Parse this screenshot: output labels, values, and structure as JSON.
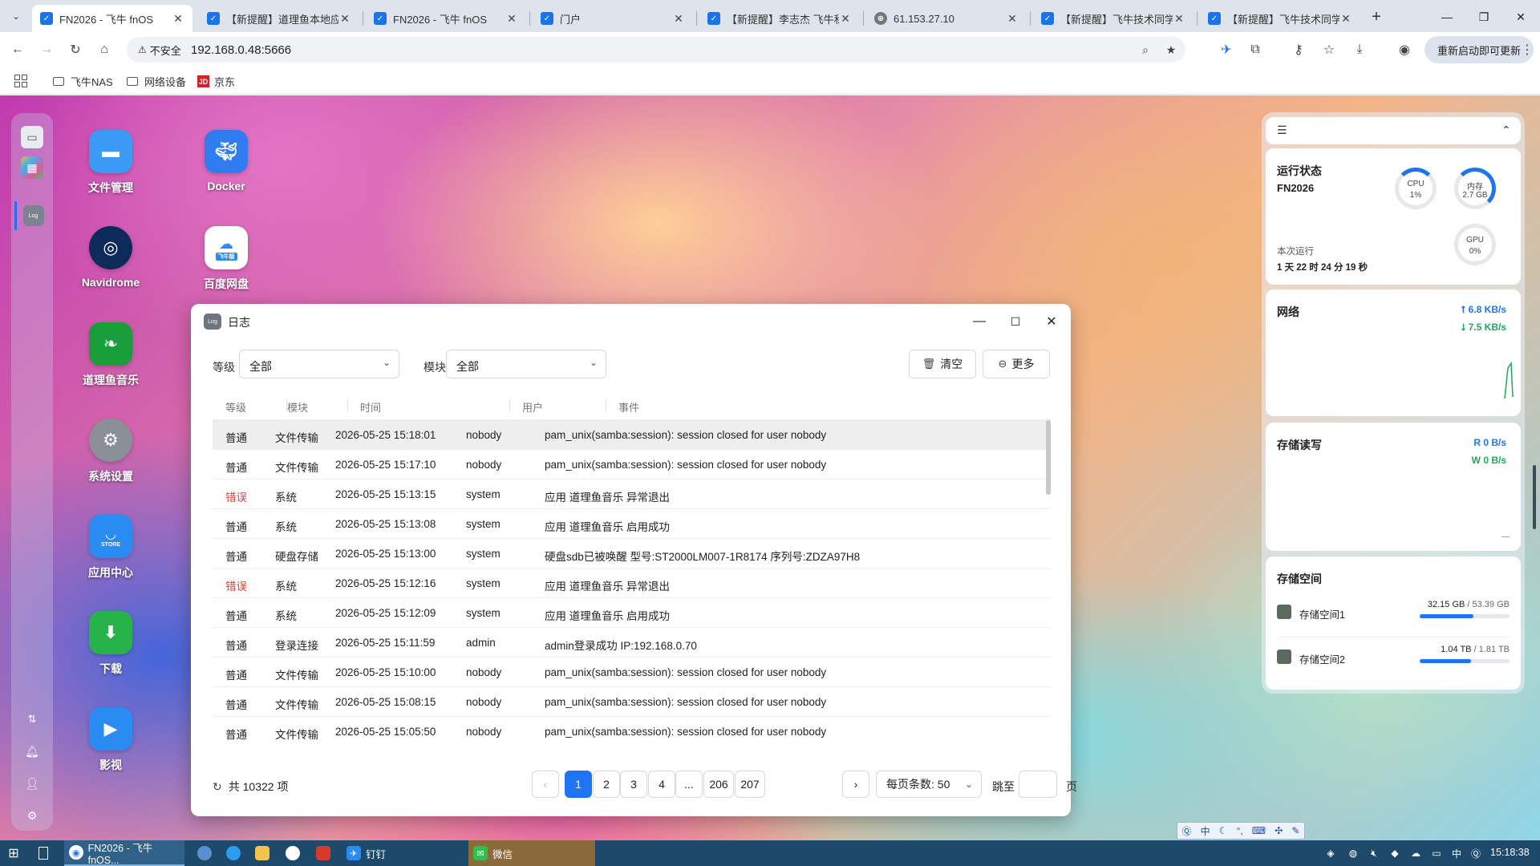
{
  "browser": {
    "tabs": [
      {
        "title": "FN2026 - 飞牛 fnOS",
        "active": true
      },
      {
        "title": "【新提醒】道理鱼本地应",
        "active": false
      },
      {
        "title": "FN2026 - 飞牛 fnOS",
        "active": false
      },
      {
        "title": "门户",
        "active": false
      },
      {
        "title": "【新提醒】李志杰 飞牛私",
        "active": false
      },
      {
        "title": "61.153.27.10",
        "active": false
      },
      {
        "title": "【新提醒】飞牛技术同学",
        "active": false
      },
      {
        "title": "【新提醒】飞牛技术同学",
        "active": false
      }
    ],
    "security_label": "不安全",
    "url": "192.168.0.48:5666",
    "restart_label": "重新启动即可更新",
    "bookmarks": [
      {
        "label": "飞牛NAS"
      },
      {
        "label": "网络设备"
      },
      {
        "label": "京东",
        "badge": "JD"
      }
    ]
  },
  "desktop": {
    "icons": [
      {
        "label": "文件管理",
        "color": "#3a9af5"
      },
      {
        "label": "Docker",
        "color": "#2f7cf0"
      },
      {
        "label": "Navidrome",
        "color": "#0d2a5a"
      },
      {
        "label": "百度网盘",
        "color": "#ffffff",
        "badge": "飞牛版"
      },
      {
        "label": "道理鱼音乐",
        "color": "#1a9e3c"
      },
      {
        "label": "系统设置",
        "color": "#8a8f98"
      },
      {
        "label": "应用中心",
        "color": "#2a8cf2",
        "badge": "STORE"
      },
      {
        "label": "下载",
        "color": "#27b34a"
      },
      {
        "label": "影视",
        "color": "#2a8cf2"
      }
    ],
    "dock_log_label": "Log"
  },
  "log_window": {
    "title": "日志",
    "app_icon_text": "Log",
    "filters": {
      "level_label": "等级",
      "level_value": "全部",
      "module_label": "模块",
      "module_value": "全部"
    },
    "buttons": {
      "clear": "清空",
      "more": "更多"
    },
    "columns": [
      "等级",
      "模块",
      "时间",
      "用户",
      "事件"
    ],
    "rows": [
      {
        "level": "普通",
        "module": "文件传输",
        "time": "2026-05-25 15:18:01",
        "user": "nobody",
        "event": "pam_unix(samba:session): session closed for user nobody",
        "error": false
      },
      {
        "level": "普通",
        "module": "文件传输",
        "time": "2026-05-25 15:17:10",
        "user": "nobody",
        "event": "pam_unix(samba:session): session closed for user nobody",
        "error": false
      },
      {
        "level": "错误",
        "module": "系统",
        "time": "2026-05-25 15:13:15",
        "user": "system",
        "event": "应用 道理鱼音乐 异常退出",
        "error": true
      },
      {
        "level": "普通",
        "module": "系统",
        "time": "2026-05-25 15:13:08",
        "user": "system",
        "event": "应用 道理鱼音乐 启用成功",
        "error": false
      },
      {
        "level": "普通",
        "module": "硬盘存储",
        "time": "2026-05-25 15:13:00",
        "user": "system",
        "event": "硬盘sdb已被唤醒 型号:ST2000LM007-1R8174 序列号:ZDZA97H8",
        "error": false
      },
      {
        "level": "错误",
        "module": "系统",
        "time": "2026-05-25 15:12:16",
        "user": "system",
        "event": "应用 道理鱼音乐 异常退出",
        "error": true
      },
      {
        "level": "普通",
        "module": "系统",
        "time": "2026-05-25 15:12:09",
        "user": "system",
        "event": "应用 道理鱼音乐 启用成功",
        "error": false
      },
      {
        "level": "普通",
        "module": "登录连接",
        "time": "2026-05-25 15:11:59",
        "user": "admin",
        "event": "admin登录成功 IP:192.168.0.70",
        "error": false
      },
      {
        "level": "普通",
        "module": "文件传输",
        "time": "2026-05-25 15:10:00",
        "user": "nobody",
        "event": "pam_unix(samba:session): session closed for user nobody",
        "error": false
      },
      {
        "level": "普通",
        "module": "文件传输",
        "time": "2026-05-25 15:08:15",
        "user": "nobody",
        "event": "pam_unix(samba:session): session closed for user nobody",
        "error": false
      },
      {
        "level": "普通",
        "module": "文件传输",
        "time": "2026-05-25 15:05:50",
        "user": "nobody",
        "event": "pam_unix(samba:session): session closed for user nobody",
        "error": false
      }
    ],
    "footer": {
      "total": "共 10322 项",
      "pages": [
        "1",
        "2",
        "3",
        "4",
        "...",
        "206",
        "207"
      ],
      "active_page": "1",
      "page_size": "每页条数: 50",
      "jump_label": "跳至",
      "page_unit": "页"
    }
  },
  "widgets": {
    "status": {
      "title": "运行状态",
      "device": "FN2026",
      "uptime_label": "本次运行",
      "uptime": "1 天 22 时 24 分 19 秒",
      "cpu_label": "CPU",
      "cpu_value": "1%",
      "mem_label": "内存",
      "mem_value": "2.7 GB",
      "gpu_label": "GPU",
      "gpu_value": "0%"
    },
    "network": {
      "title": "网络",
      "up": "6.8 KB/s",
      "down": "7.5 KB/s"
    },
    "storage_io": {
      "title": "存储读写",
      "read": "R 0 B/s",
      "write": "W 0 B/s"
    },
    "storage_space": {
      "title": "存储空间",
      "items": [
        {
          "name": "存储空间1",
          "used": "32.15 GB",
          "total": "/ 53.39 GB",
          "fraction": 0.6
        },
        {
          "name": "存储空间2",
          "used": "1.04 TB",
          "total": "/ 1.81 TB",
          "fraction": 0.57
        }
      ]
    }
  },
  "taskbar": {
    "items": [
      {
        "label": "FN2026 - 飞牛 fnOS..."
      },
      {
        "label": "钉钉"
      },
      {
        "label": "微信"
      }
    ],
    "ime_lang": "中",
    "clock": "15:18:38"
  }
}
